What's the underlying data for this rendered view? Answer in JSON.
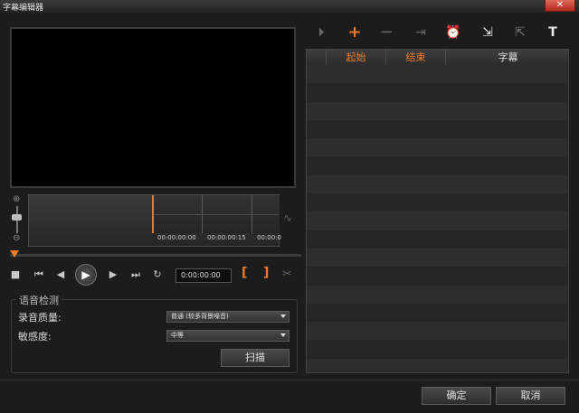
{
  "window": {
    "title": "字幕编辑器",
    "close_symbol": "✕"
  },
  "timeline": {
    "timecodes": [
      "00:00:00:00",
      "00:00:00:15",
      "00:00:0"
    ]
  },
  "transport": {
    "timecode": "0:00:00:00",
    "mark_in": "[",
    "mark_out": "]"
  },
  "speech_detection": {
    "group_label": "语音检测",
    "quality_label": "录音质量:",
    "quality_value": "普通 (较多背景噪音)",
    "sensitivity_label": "敏感度:",
    "sensitivity_value": "中等",
    "scan_label": "扫描"
  },
  "toolbar": {
    "icons": [
      "play-subtitle-icon",
      "add-icon",
      "remove-icon",
      "split-icon",
      "text-options-icon",
      "import-icon",
      "export-icon",
      "text-style-icon"
    ],
    "accent": "#f07a2a"
  },
  "subtitle_list": {
    "columns": [
      "",
      "起始",
      "结束",
      "字幕"
    ]
  },
  "footer": {
    "ok_label": "确定",
    "cancel_label": "取消"
  }
}
